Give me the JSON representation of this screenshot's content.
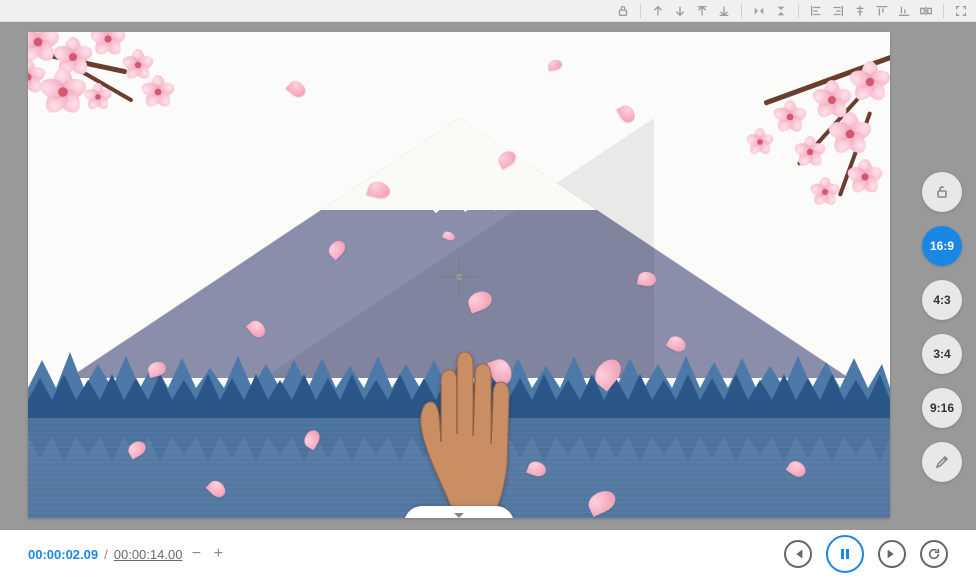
{
  "toolbar": {
    "icons": [
      "lock-icon",
      "arrow-up-icon",
      "arrow-down-icon",
      "bring-front-icon",
      "send-back-icon",
      "flip-horizontal-icon",
      "flip-vertical-icon",
      "align-left-icon",
      "align-right-icon",
      "align-center-icon",
      "align-top-icon",
      "align-bottom-icon",
      "distribute-icon",
      "expand-icon"
    ]
  },
  "ratio": {
    "lock_label": "unlock",
    "options": [
      "16:9",
      "4:3",
      "3:4",
      "9:16"
    ],
    "active": "16:9",
    "edit_label": "edit"
  },
  "playback": {
    "current": "00:00:02.09",
    "separator": "/",
    "total": "00:00:14.00",
    "zoom_out": "−",
    "zoom_in": "+"
  },
  "controls": {
    "prev": "previous",
    "pause": "pause",
    "next": "next",
    "replay": "replay"
  },
  "canvas": {
    "drawer_label": "expand"
  }
}
